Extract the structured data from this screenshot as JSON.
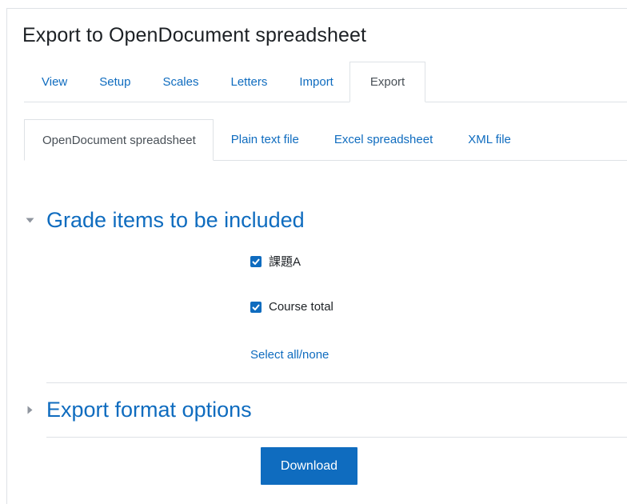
{
  "page": {
    "title": "Export to OpenDocument spreadsheet"
  },
  "primary_tabs": [
    {
      "label": "View",
      "active": false
    },
    {
      "label": "Setup",
      "active": false
    },
    {
      "label": "Scales",
      "active": false
    },
    {
      "label": "Letters",
      "active": false
    },
    {
      "label": "Import",
      "active": false
    },
    {
      "label": "Export",
      "active": true
    }
  ],
  "secondary_tabs": [
    {
      "label": "OpenDocument spreadsheet",
      "active": true
    },
    {
      "label": "Plain text file",
      "active": false
    },
    {
      "label": "Excel spreadsheet",
      "active": false
    },
    {
      "label": "XML file",
      "active": false
    }
  ],
  "grade_items_section": {
    "title": "Grade items to be included",
    "expanded": true,
    "items": [
      {
        "label": "課題A",
        "checked": true
      },
      {
        "label": "Course total",
        "checked": true
      }
    ],
    "select_all_label": "Select all/none"
  },
  "export_options_section": {
    "title": "Export format options",
    "expanded": false
  },
  "download_button": {
    "label": "Download"
  },
  "colors": {
    "accent": "#0f6cbf",
    "text": "#1d2125",
    "border": "#dee2e6",
    "muted": "#495057"
  },
  "icons": {
    "expanded_caret": "caret-down-icon",
    "collapsed_caret": "caret-right-icon",
    "checkbox_check": "check-icon"
  }
}
